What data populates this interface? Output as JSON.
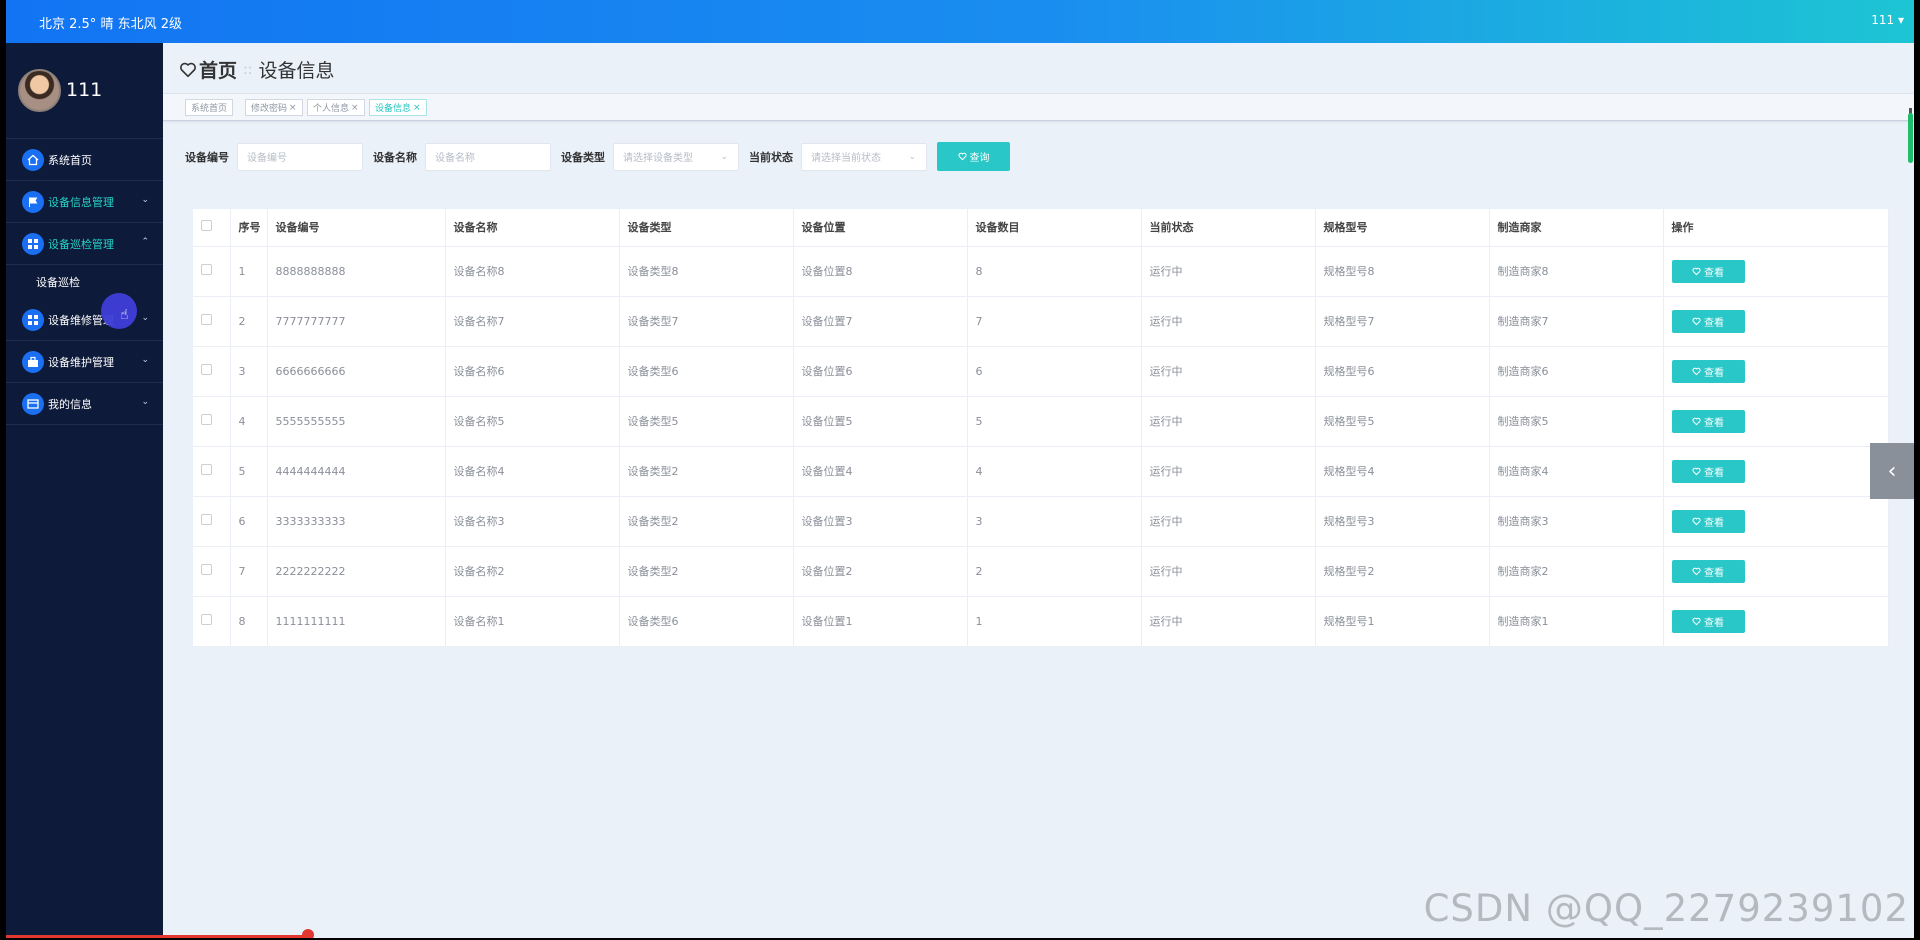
{
  "topbar": {
    "weather": "北京  2.5°  晴  东北风  2级",
    "user": "111 ▾"
  },
  "profile": {
    "name": "111"
  },
  "menu": [
    {
      "label": "系统首页",
      "icon": "home-icon"
    },
    {
      "label": "设备信息管理",
      "icon": "flag-icon",
      "chevron": "⌄"
    },
    {
      "label": "设备巡检管理",
      "icon": "grid-icon",
      "chevron": "⌃"
    },
    {
      "label": "设备维修管理",
      "icon": "grid-icon",
      "chevron": "⌄"
    },
    {
      "label": "设备维护管理",
      "icon": "briefcase-icon",
      "chevron": "⌄"
    },
    {
      "label": "我的信息",
      "icon": "card-icon",
      "chevron": "⌄"
    }
  ],
  "submenu": {
    "label": "设备巡检"
  },
  "breadcrumb": {
    "home": "首页",
    "separator": "::",
    "current": "设备信息"
  },
  "tags": [
    {
      "label": "系统首页",
      "closable": false
    },
    {
      "label": "修改密码",
      "closable": true
    },
    {
      "label": "个人信息",
      "closable": true
    },
    {
      "label": "设备信息",
      "closable": true,
      "active": true
    }
  ],
  "search": {
    "code_label": "设备编号",
    "code_placeholder": "设备编号",
    "name_label": "设备名称",
    "name_placeholder": "设备名称",
    "type_label": "设备类型",
    "type_placeholder": "请选择设备类型",
    "status_label": "当前状态",
    "status_placeholder": "请选择当前状态",
    "query_label": "查询"
  },
  "table": {
    "headers": [
      "序号",
      "设备编号",
      "设备名称",
      "设备类型",
      "设备位置",
      "设备数目",
      "当前状态",
      "规格型号",
      "制造商家",
      "操作"
    ],
    "action_label": "查看",
    "rows": [
      [
        "1",
        "8888888888",
        "设备名称8",
        "设备类型8",
        "设备位置8",
        "8",
        "运行中",
        "规格型号8",
        "制造商家8"
      ],
      [
        "2",
        "7777777777",
        "设备名称7",
        "设备类型7",
        "设备位置7",
        "7",
        "运行中",
        "规格型号7",
        "制造商家7"
      ],
      [
        "3",
        "6666666666",
        "设备名称6",
        "设备类型6",
        "设备位置6",
        "6",
        "运行中",
        "规格型号6",
        "制造商家6"
      ],
      [
        "4",
        "5555555555",
        "设备名称5",
        "设备类型5",
        "设备位置5",
        "5",
        "运行中",
        "规格型号5",
        "制造商家5"
      ],
      [
        "5",
        "4444444444",
        "设备名称4",
        "设备类型2",
        "设备位置4",
        "4",
        "运行中",
        "规格型号4",
        "制造商家4"
      ],
      [
        "6",
        "3333333333",
        "设备名称3",
        "设备类型2",
        "设备位置3",
        "3",
        "运行中",
        "规格型号3",
        "制造商家3"
      ],
      [
        "7",
        "2222222222",
        "设备名称2",
        "设备类型2",
        "设备位置2",
        "2",
        "运行中",
        "规格型号2",
        "制造商家2"
      ],
      [
        "8",
        "1111111111",
        "设备名称1",
        "设备类型6",
        "设备位置1",
        "1",
        "运行中",
        "规格型号1",
        "制造商家1"
      ]
    ]
  },
  "collapse_icon": "chevron-left-icon",
  "watermark": "CSDN @QQ_2279239102",
  "colors": {
    "topbar_start": "#1274f3",
    "topbar_end": "#1dc5d4",
    "sidebar": "#0e1a3a",
    "accent": "#29c7c7",
    "active_menu": "#25d3c8"
  }
}
